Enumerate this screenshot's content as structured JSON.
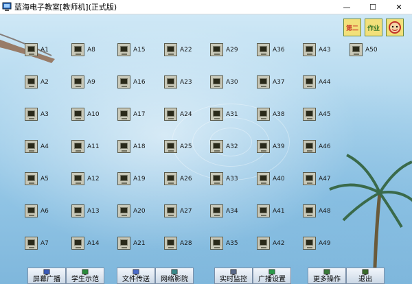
{
  "window": {
    "title": "蓝海电子教室[教师机](正式版)",
    "controls": {
      "minimize": "—",
      "maximize": "☐",
      "close": "✕"
    }
  },
  "corner_tools": [
    {
      "label": "第二",
      "color": "#c83a2a",
      "icon": "checklist-icon"
    },
    {
      "label": "作业",
      "color": "#3d7a2a",
      "icon": "homework-icon"
    },
    {
      "label": "",
      "color": "#d0302a",
      "icon": "teacher-face-icon"
    }
  ],
  "students": [
    {
      "id": "A1"
    },
    {
      "id": "A2"
    },
    {
      "id": "A3"
    },
    {
      "id": "A4"
    },
    {
      "id": "A5"
    },
    {
      "id": "A6"
    },
    {
      "id": "A7"
    },
    {
      "id": "A8"
    },
    {
      "id": "A9"
    },
    {
      "id": "A10"
    },
    {
      "id": "A11"
    },
    {
      "id": "A12"
    },
    {
      "id": "A13"
    },
    {
      "id": "A14"
    },
    {
      "id": "A15"
    },
    {
      "id": "A16"
    },
    {
      "id": "A17"
    },
    {
      "id": "A18"
    },
    {
      "id": "A19"
    },
    {
      "id": "A20"
    },
    {
      "id": "A21"
    },
    {
      "id": "A22"
    },
    {
      "id": "A23"
    },
    {
      "id": "A24"
    },
    {
      "id": "A25"
    },
    {
      "id": "A26"
    },
    {
      "id": "A27"
    },
    {
      "id": "A28"
    },
    {
      "id": "A29"
    },
    {
      "id": "A30"
    },
    {
      "id": "A31"
    },
    {
      "id": "A32"
    },
    {
      "id": "A33"
    },
    {
      "id": "A34"
    },
    {
      "id": "A35"
    },
    {
      "id": "A36"
    },
    {
      "id": "A37"
    },
    {
      "id": "A38"
    },
    {
      "id": "A39"
    },
    {
      "id": "A40"
    },
    {
      "id": "A41"
    },
    {
      "id": "A42"
    },
    {
      "id": "A43"
    },
    {
      "id": "A44"
    },
    {
      "id": "A45"
    },
    {
      "id": "A46"
    },
    {
      "id": "A47"
    },
    {
      "id": "A48"
    },
    {
      "id": "A49"
    },
    {
      "id": "A50"
    }
  ],
  "toolbar": [
    {
      "label": "屏幕广播",
      "icon": "broadcast-icon"
    },
    {
      "label": "学生示范",
      "icon": "student-demo-icon"
    },
    {
      "label": "文件传送",
      "icon": "file-transfer-icon"
    },
    {
      "label": "网络影院",
      "icon": "network-cinema-icon"
    },
    {
      "label": "实时监控",
      "icon": "monitor-icon"
    },
    {
      "label": "广播设置",
      "icon": "broadcast-settings-icon"
    },
    {
      "label": "更多操作",
      "icon": "more-actions-icon"
    },
    {
      "label": "退出",
      "icon": "exit-icon"
    }
  ],
  "colors": {
    "monitor_body": "#c8c8b8",
    "monitor_screen": "#2a2a1a",
    "background": "#a9d3ec"
  }
}
